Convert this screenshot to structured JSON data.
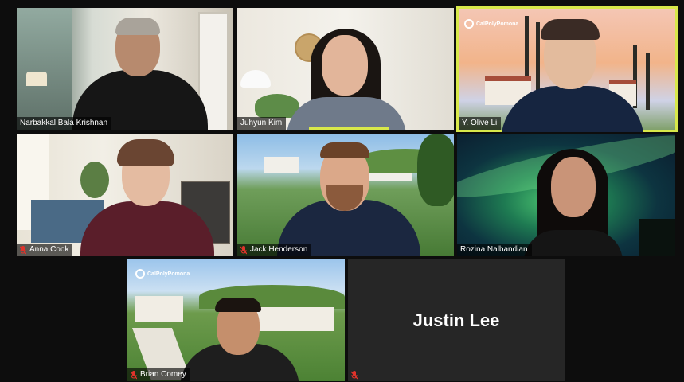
{
  "participants": [
    {
      "name": "Narbakkal Bala Krishnan",
      "muted": false
    },
    {
      "name": "Juhyun Kim",
      "muted": false
    },
    {
      "name": "Y. Olive Li",
      "muted": false,
      "active_speaker": true
    },
    {
      "name": "Anna Cook",
      "muted": true
    },
    {
      "name": "Jack Henderson",
      "muted": true
    },
    {
      "name": "Rozina Nalbandian",
      "muted": false
    },
    {
      "name": "Brian Comey",
      "muted": true
    },
    {
      "name": "Justin Lee",
      "muted": true,
      "video_off": true
    }
  ],
  "logo_text": "CalPolyPomona",
  "colors": {
    "active_border": "#d8e84a",
    "muted_icon": "#e0332b",
    "background": "#0d0d0d"
  }
}
